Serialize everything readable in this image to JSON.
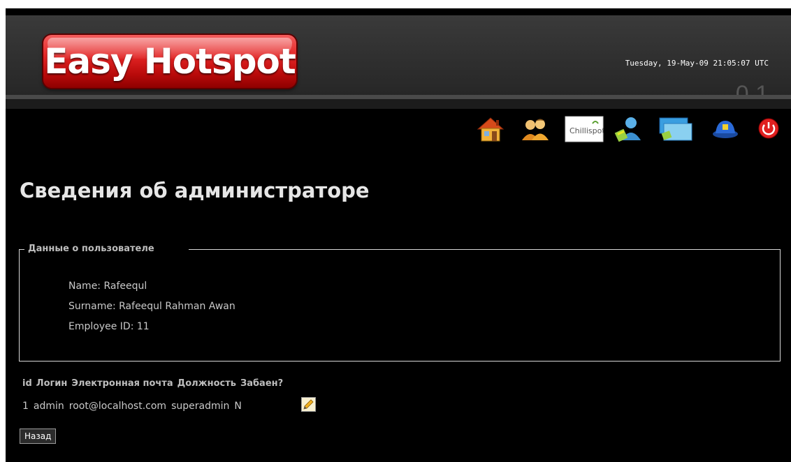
{
  "header": {
    "logo_text": "Easy Hotspot",
    "datetime": "Tuesday, 19-May-09 21:05:07 UTC",
    "version": "0.1"
  },
  "toolbar": {
    "icons": [
      {
        "name": "home-icon"
      },
      {
        "name": "users-icon"
      },
      {
        "name": "chillispot-icon",
        "label": "Chillispot"
      },
      {
        "name": "admins-icon"
      },
      {
        "name": "billing-icon"
      },
      {
        "name": "security-icon"
      },
      {
        "name": "power-icon"
      }
    ]
  },
  "page": {
    "title": "Сведения об администраторе"
  },
  "user_info": {
    "legend": "Данные о пользователе",
    "name": "Name: Rafeequl",
    "surname": "Surname: Rafeequl Rahman Awan",
    "employee_id": "Employee ID: 11"
  },
  "table": {
    "headers": [
      "id",
      "Логин",
      "Электронная почта",
      "Должность",
      "Забаен?"
    ],
    "row": [
      "1",
      "admin",
      "root@localhost.com",
      "superadmin",
      "N"
    ]
  },
  "actions": {
    "back_label": "Назад"
  },
  "colors": {
    "background": "#000000",
    "logo_red": "#e22424",
    "text": "#c9c9c9"
  }
}
